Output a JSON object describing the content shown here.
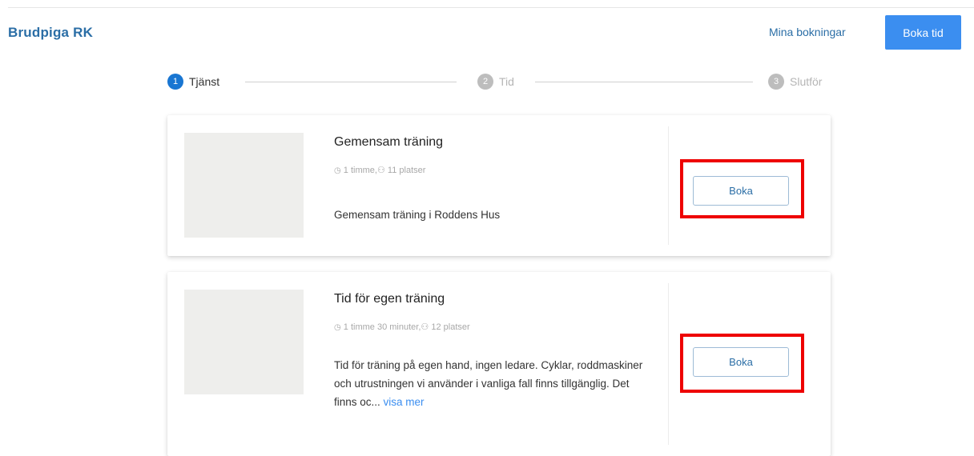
{
  "header": {
    "brand": "Brudpiga RK",
    "my_bookings": "Mina bokningar",
    "book_time": "Boka tid"
  },
  "stepper": [
    {
      "number": "1",
      "label": "Tjänst",
      "active": true
    },
    {
      "number": "2",
      "label": "Tid",
      "active": false
    },
    {
      "number": "3",
      "label": "Slutför",
      "active": false
    }
  ],
  "services": [
    {
      "title": "Gemensam träning",
      "duration": "1 timme",
      "spots": "11 platser",
      "description": "Gemensam träning i Roddens Hus",
      "button": "Boka"
    },
    {
      "title": "Tid för egen träning",
      "duration": "1 timme 30 minuter",
      "spots": "12 platser",
      "description": "Tid för träning på egen hand, ingen ledare. Cyklar, roddmaskiner och utrustningen vi använder i vanliga fall finns tillgänglig. Det finns oc...",
      "more": "visa mer",
      "button": "Boka"
    }
  ],
  "colors": {
    "accent": "#3b8ef0",
    "brand": "#2b6ea6",
    "highlight": "#ee0000"
  }
}
